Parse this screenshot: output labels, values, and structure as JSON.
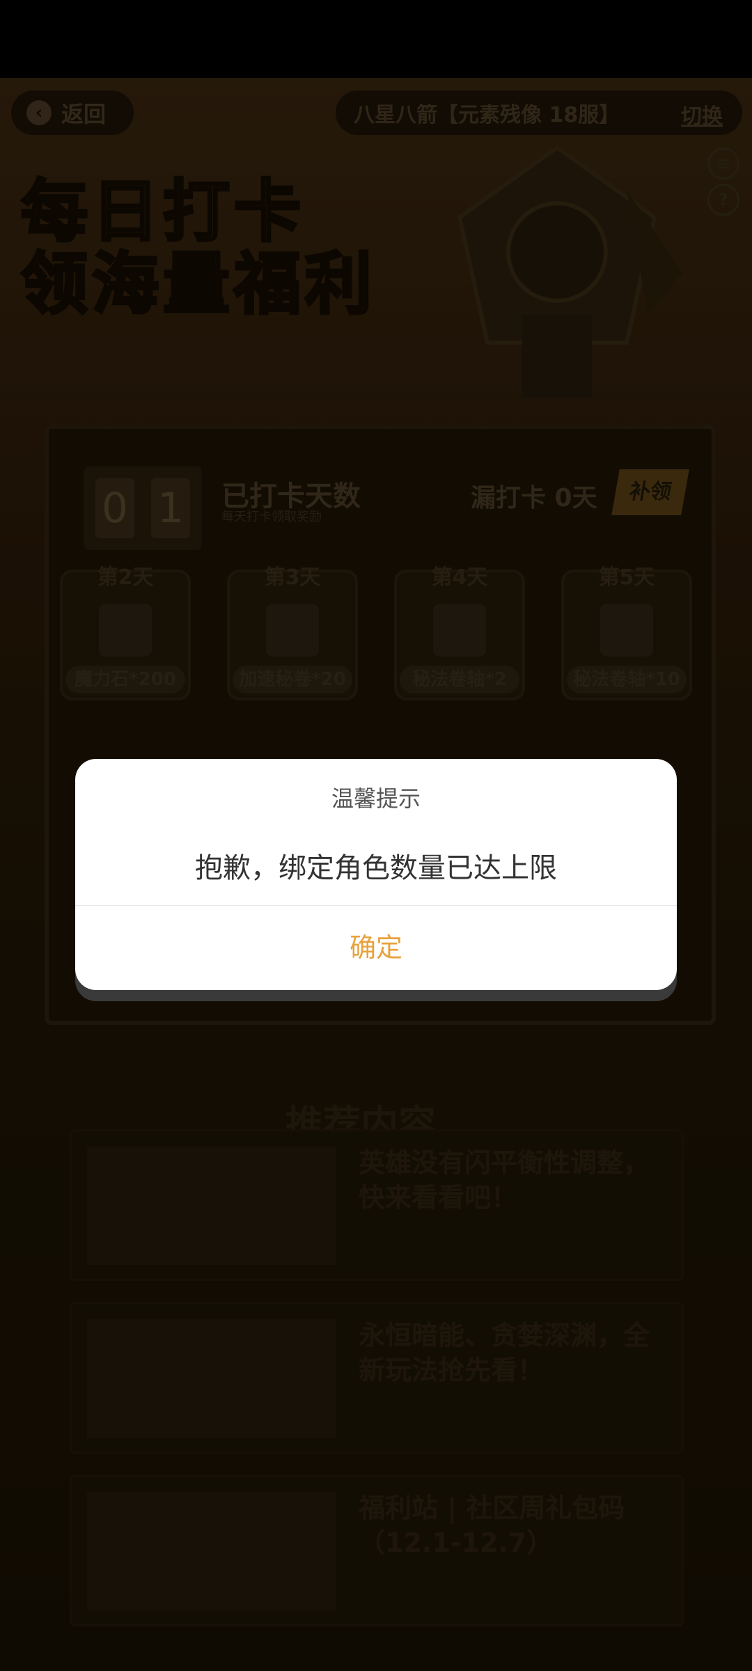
{
  "topbar": {
    "back_label": "返回",
    "role_name": "八星八箭【元素残像 18服】",
    "switch_label": "切换"
  },
  "banner": {
    "title_line1": "每日打卡",
    "title_line2": "领海量福利"
  },
  "checkin": {
    "digits": [
      "0",
      "1"
    ],
    "label": "已打卡天数",
    "sub_label": "每天打卡领取奖励",
    "missed_label": "漏打卡 0天",
    "makeup_label": "补领"
  },
  "rewards": [
    {
      "day": "第2天",
      "name": "魔力石*200"
    },
    {
      "day": "第3天",
      "name": "加速秘卷*20"
    },
    {
      "day": "第4天",
      "name": "秘法卷轴*2"
    },
    {
      "day": "第5天",
      "name": "秘法卷轴*10"
    }
  ],
  "recommend": {
    "title": "推荐内容",
    "items": [
      {
        "title": "英雄没有闪平衡性调整，快来看看吧！"
      },
      {
        "title": "永恒暗能、贪婪深渊，全新玩法抢先看！"
      },
      {
        "title": "福利站 | 社区周礼包码（12.1-12.7）"
      }
    ]
  },
  "dialog": {
    "title": "温馨提示",
    "message": "抱歉，绑定角色数量已达上限",
    "confirm_label": "确定"
  },
  "colors": {
    "confirm": "#e8a23c",
    "dialog_bg": "#ffffff",
    "status_bar": "#000000"
  },
  "icons": {
    "back": "chevron-left-icon",
    "menu": "menu-icon",
    "help": "help-icon"
  }
}
